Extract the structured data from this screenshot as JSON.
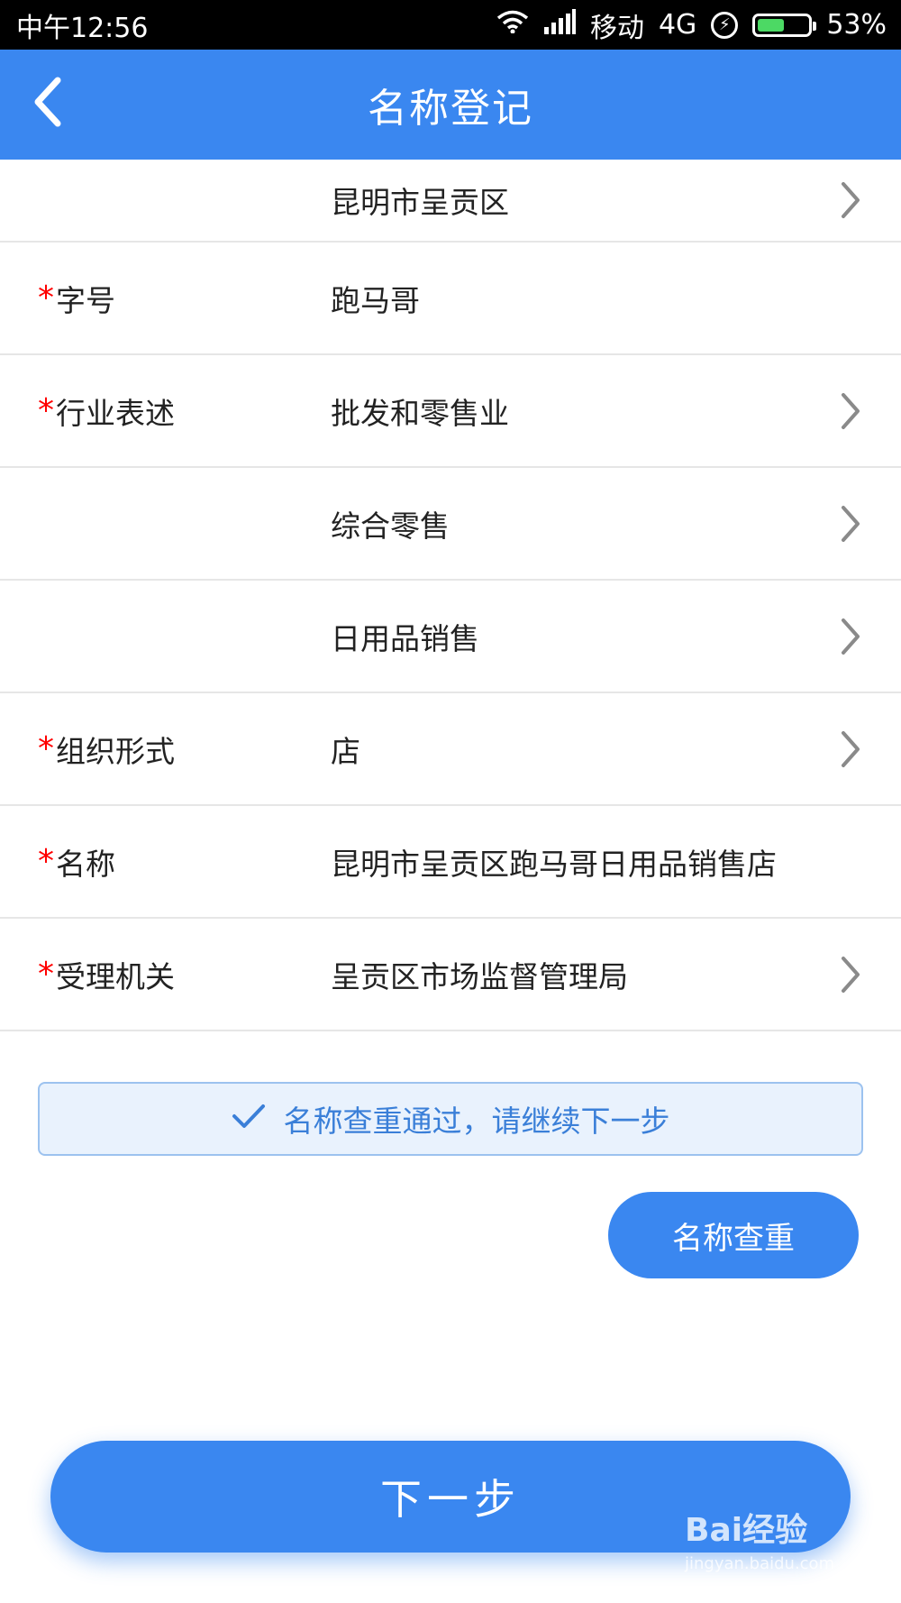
{
  "status_bar": {
    "time": "中午12:56",
    "carrier": "移动",
    "network": "4G",
    "battery_percent": "53%",
    "battery_level": 0.53
  },
  "header": {
    "title": "名称登记"
  },
  "rows": [
    {
      "label": "",
      "value": "昆明市呈贡区",
      "required": false,
      "has_chevron": true
    },
    {
      "label": "字号",
      "value": "跑马哥",
      "required": true,
      "has_chevron": false
    },
    {
      "label": "行业表述",
      "value": "批发和零售业",
      "required": true,
      "has_chevron": true
    },
    {
      "label": "",
      "value": "综合零售",
      "required": false,
      "has_chevron": true
    },
    {
      "label": "",
      "value": "日用品销售",
      "required": false,
      "has_chevron": true
    },
    {
      "label": "组织形式",
      "value": "店",
      "required": true,
      "has_chevron": true
    },
    {
      "label": "名称",
      "value": "昆明市呈贡区跑马哥日用品销售店",
      "required": true,
      "has_chevron": false
    },
    {
      "label": "受理机关",
      "value": "呈贡区市场监督管理局",
      "required": true,
      "has_chevron": true
    }
  ],
  "required_mark": "*",
  "notice": {
    "text": "名称查重通过，请继续下一步"
  },
  "buttons": {
    "name_check": "名称查重",
    "next": "下一步"
  },
  "watermark": {
    "logo": "Bai经验",
    "url": "jingyan.baidu.com"
  },
  "colors": {
    "primary": "#3a87f0",
    "required": "#ff0000",
    "notice_bg": "#e9f2fd",
    "notice_text": "#3a7fd8"
  }
}
